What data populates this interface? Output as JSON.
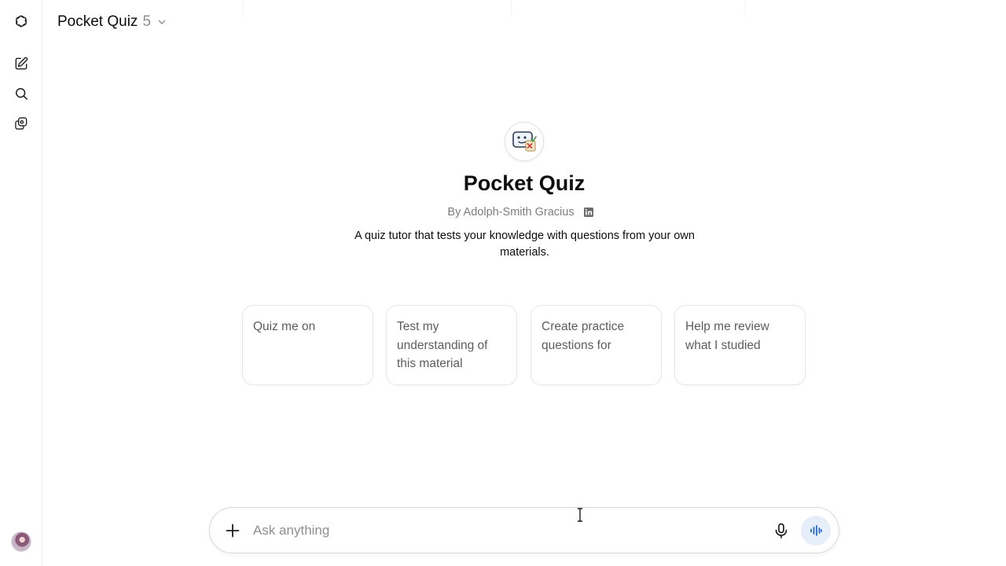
{
  "header": {
    "model_name": "Pocket Quiz",
    "model_version": "5"
  },
  "rail": {
    "icons": [
      "openai-logo-icon",
      "new-chat-icon",
      "search-icon",
      "gpts-icon",
      "avatar"
    ]
  },
  "gpt": {
    "title": "Pocket Quiz",
    "author": "By Adolph-Smith Gracius",
    "description": "A quiz tutor that tests your knowledge with questions from your own materials."
  },
  "starters": [
    {
      "label": "Quiz me on"
    },
    {
      "label": "Test my understanding of this material"
    },
    {
      "label": "Create practice questions for"
    },
    {
      "label": "Help me review what I studied"
    }
  ],
  "composer": {
    "placeholder": "Ask anything"
  },
  "colors": {
    "accent": "#1c5fd1",
    "voice_button_bg": "#e6eefa",
    "muted_text": "#7d7d7d"
  }
}
